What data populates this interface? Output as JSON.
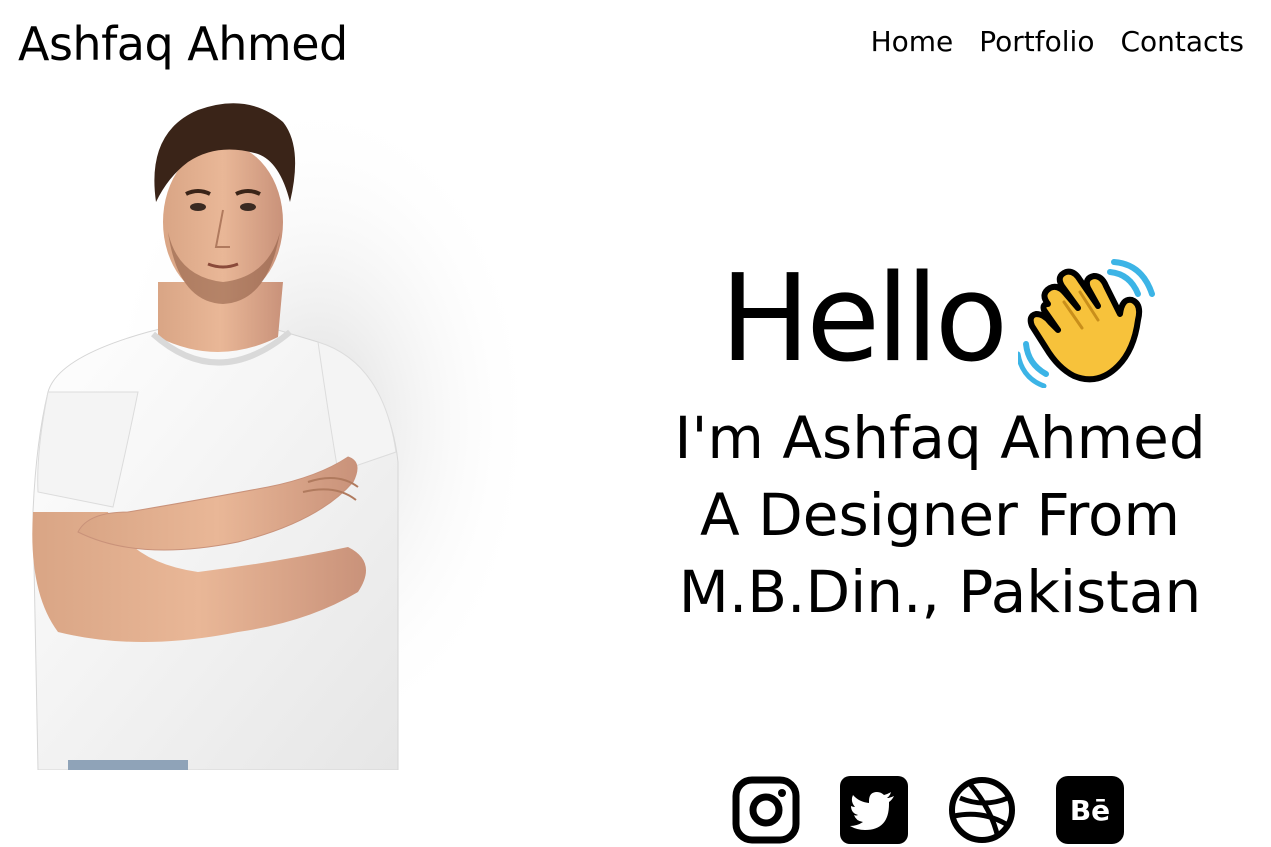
{
  "header": {
    "brand": "Ashfaq Ahmed",
    "nav": [
      {
        "label": "Home"
      },
      {
        "label": "Portfolio"
      },
      {
        "label": "Contacts"
      }
    ]
  },
  "hero": {
    "greeting": "Hello",
    "lines": [
      "I'm Ashfaq Ahmed",
      "A Designer From",
      "M.B.Din., Pakistan"
    ],
    "wave_icon": "waving-hand-icon"
  },
  "portrait": {
    "icon": "profile-photo"
  },
  "social": [
    {
      "icon": "instagram-icon"
    },
    {
      "icon": "twitter-icon"
    },
    {
      "icon": "dribbble-icon"
    },
    {
      "icon": "behance-icon"
    }
  ],
  "colors": {
    "text": "#000000",
    "background": "#ffffff",
    "wave_yellow": "#f7c23b",
    "wave_blue": "#3cb4e6"
  }
}
